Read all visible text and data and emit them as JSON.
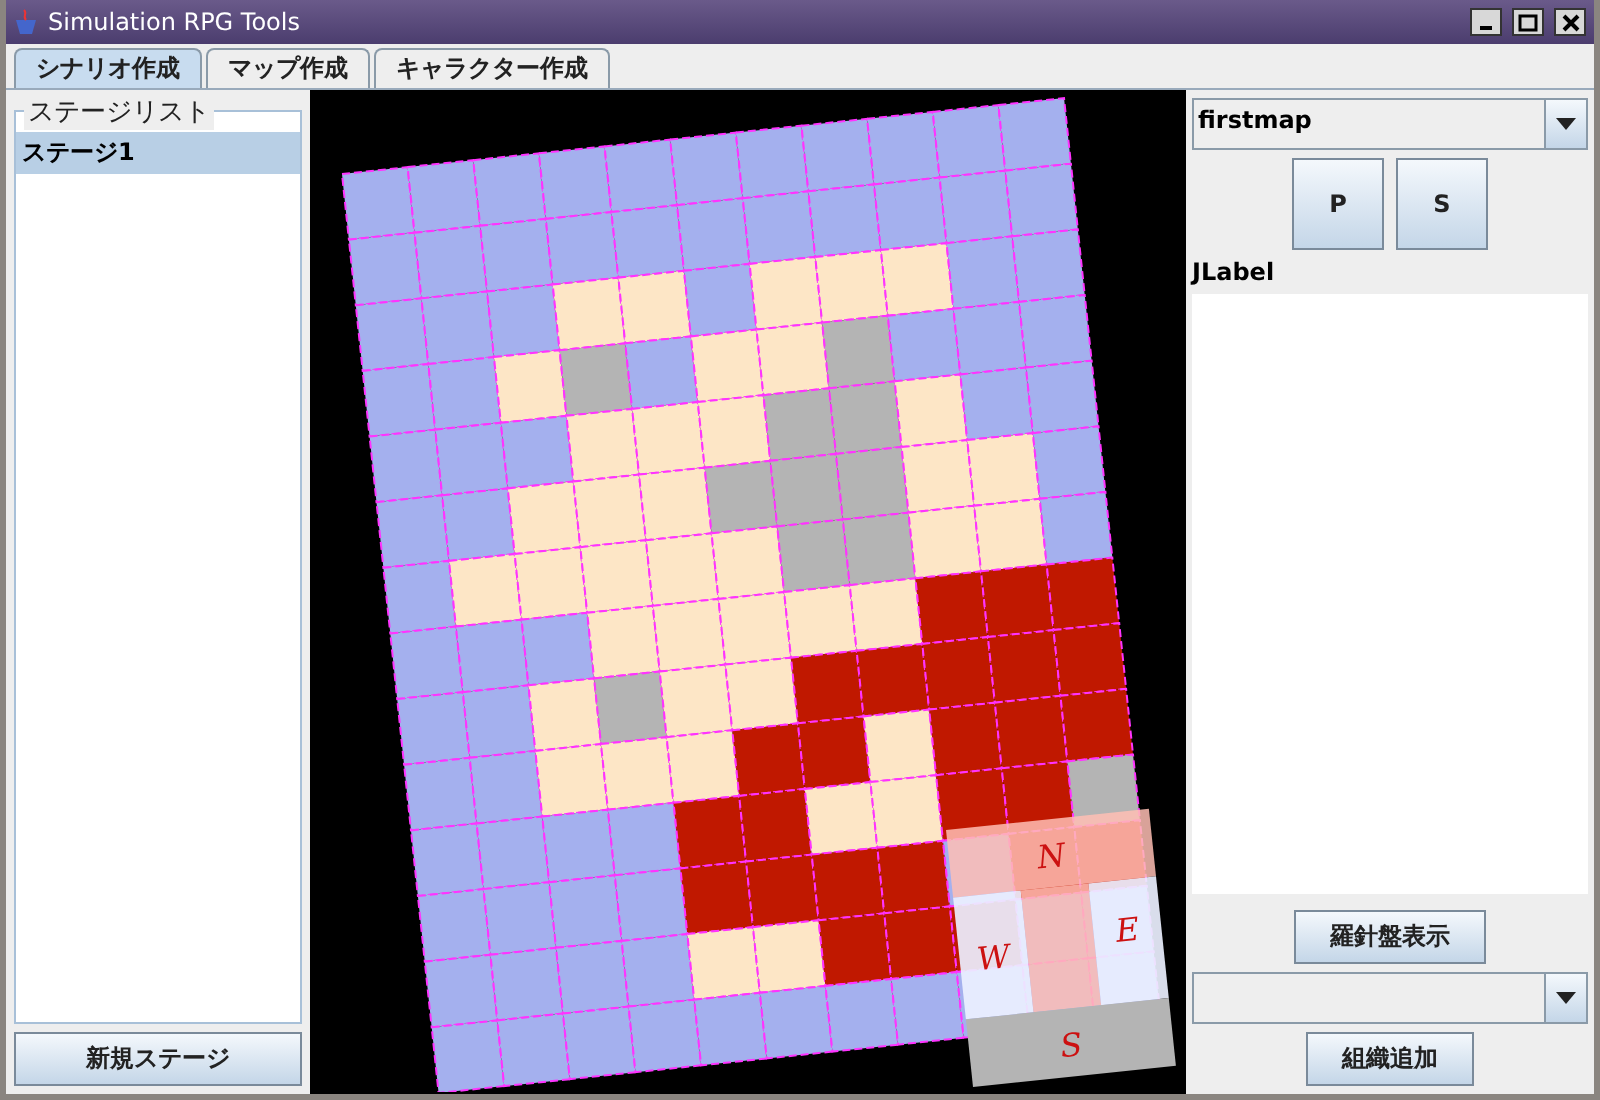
{
  "window": {
    "title": "Simulation RPG Tools"
  },
  "tabs": [
    {
      "label": "シナリオ作成",
      "selected": true
    },
    {
      "label": "マップ作成",
      "selected": false
    },
    {
      "label": "キャラクター作成",
      "selected": false
    }
  ],
  "stage_list": {
    "title": "ステージリスト",
    "items": [
      {
        "label": "ステージ1",
        "selected": true
      }
    ],
    "new_button": "新規ステージ"
  },
  "map": {
    "compass": {
      "north": "N",
      "east": "E",
      "west": "W",
      "south": "S"
    }
  },
  "right_panel": {
    "map_select": {
      "value": "firstmap"
    },
    "buttons": [
      "P",
      "S"
    ],
    "label": "JLabel",
    "compass_button": "羅針盤表示",
    "add_button": "組織追加"
  }
}
